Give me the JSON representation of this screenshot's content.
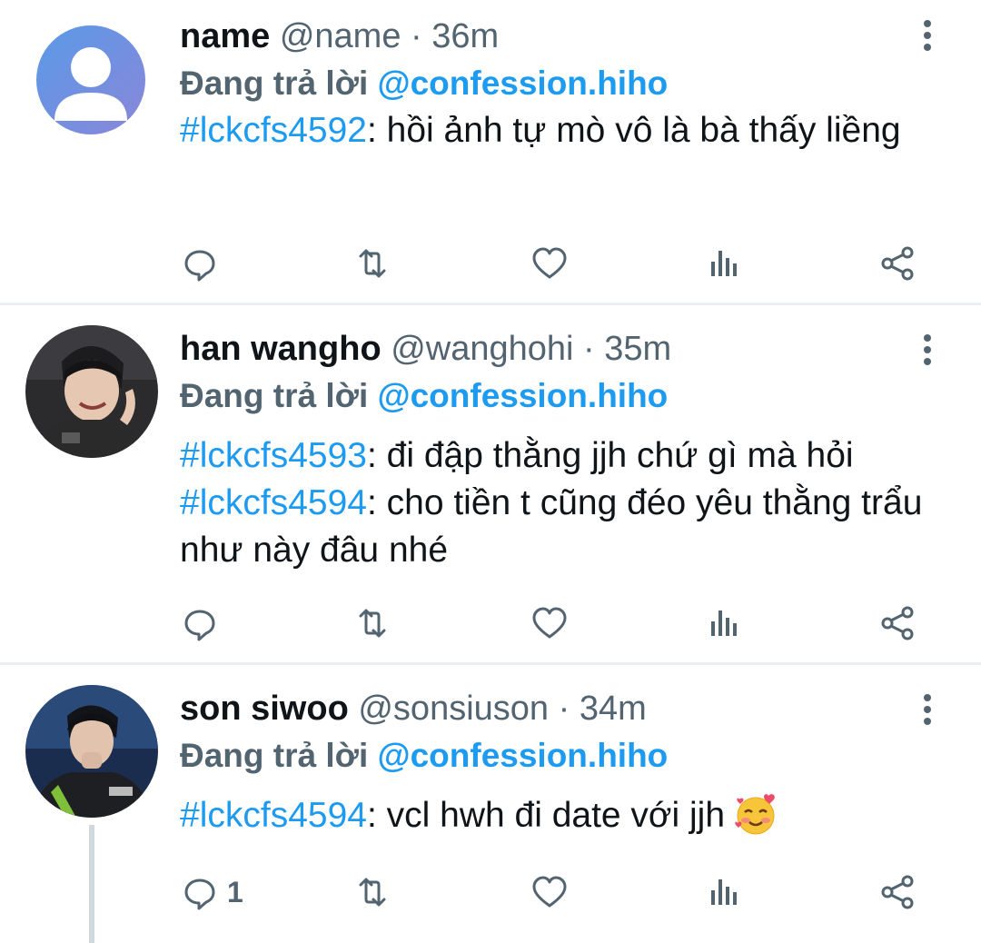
{
  "tweets": [
    {
      "display_name": "name",
      "handle": "@name",
      "time": "36m",
      "reply_prefix": "Đang trả lời",
      "reply_to": "@confession.hiho",
      "lines": [
        {
          "hashtag": "#lckcfs4592",
          "text": ": hồi ảnh tự mò vô là bà thấy liềng"
        }
      ],
      "reply_count": ""
    },
    {
      "display_name": "han wangho",
      "handle": "@wanghohi",
      "time": "35m",
      "reply_prefix": "Đang trả lời",
      "reply_to": "@confession.hiho",
      "lines": [
        {
          "hashtag": "#lckcfs4593",
          "text": ": đi đập thằng jjh chứ gì mà hỏi"
        },
        {
          "hashtag": "#lckcfs4594",
          "text": ": cho tiền t cũng đéo yêu thằng trẩu như này đâu nhé"
        }
      ],
      "reply_count": ""
    },
    {
      "display_name": "son siwoo",
      "handle": "@sonsiuson",
      "time": "34m",
      "reply_prefix": "Đang trả lời",
      "reply_to": "@confession.hiho",
      "lines": [
        {
          "hashtag": "#lckcfs4594",
          "text": ": vcl hwh đi date với jjh"
        }
      ],
      "reply_count": "1"
    }
  ],
  "separator": "·",
  "icons": [
    "reply-icon",
    "retweet-icon",
    "like-icon",
    "views-icon",
    "share-icon",
    "more-icon",
    "smiling-face-with-hearts-emoji"
  ],
  "colors": {
    "accent": "#1d9bf0",
    "secondary": "#536471",
    "divider": "#eceff1"
  }
}
